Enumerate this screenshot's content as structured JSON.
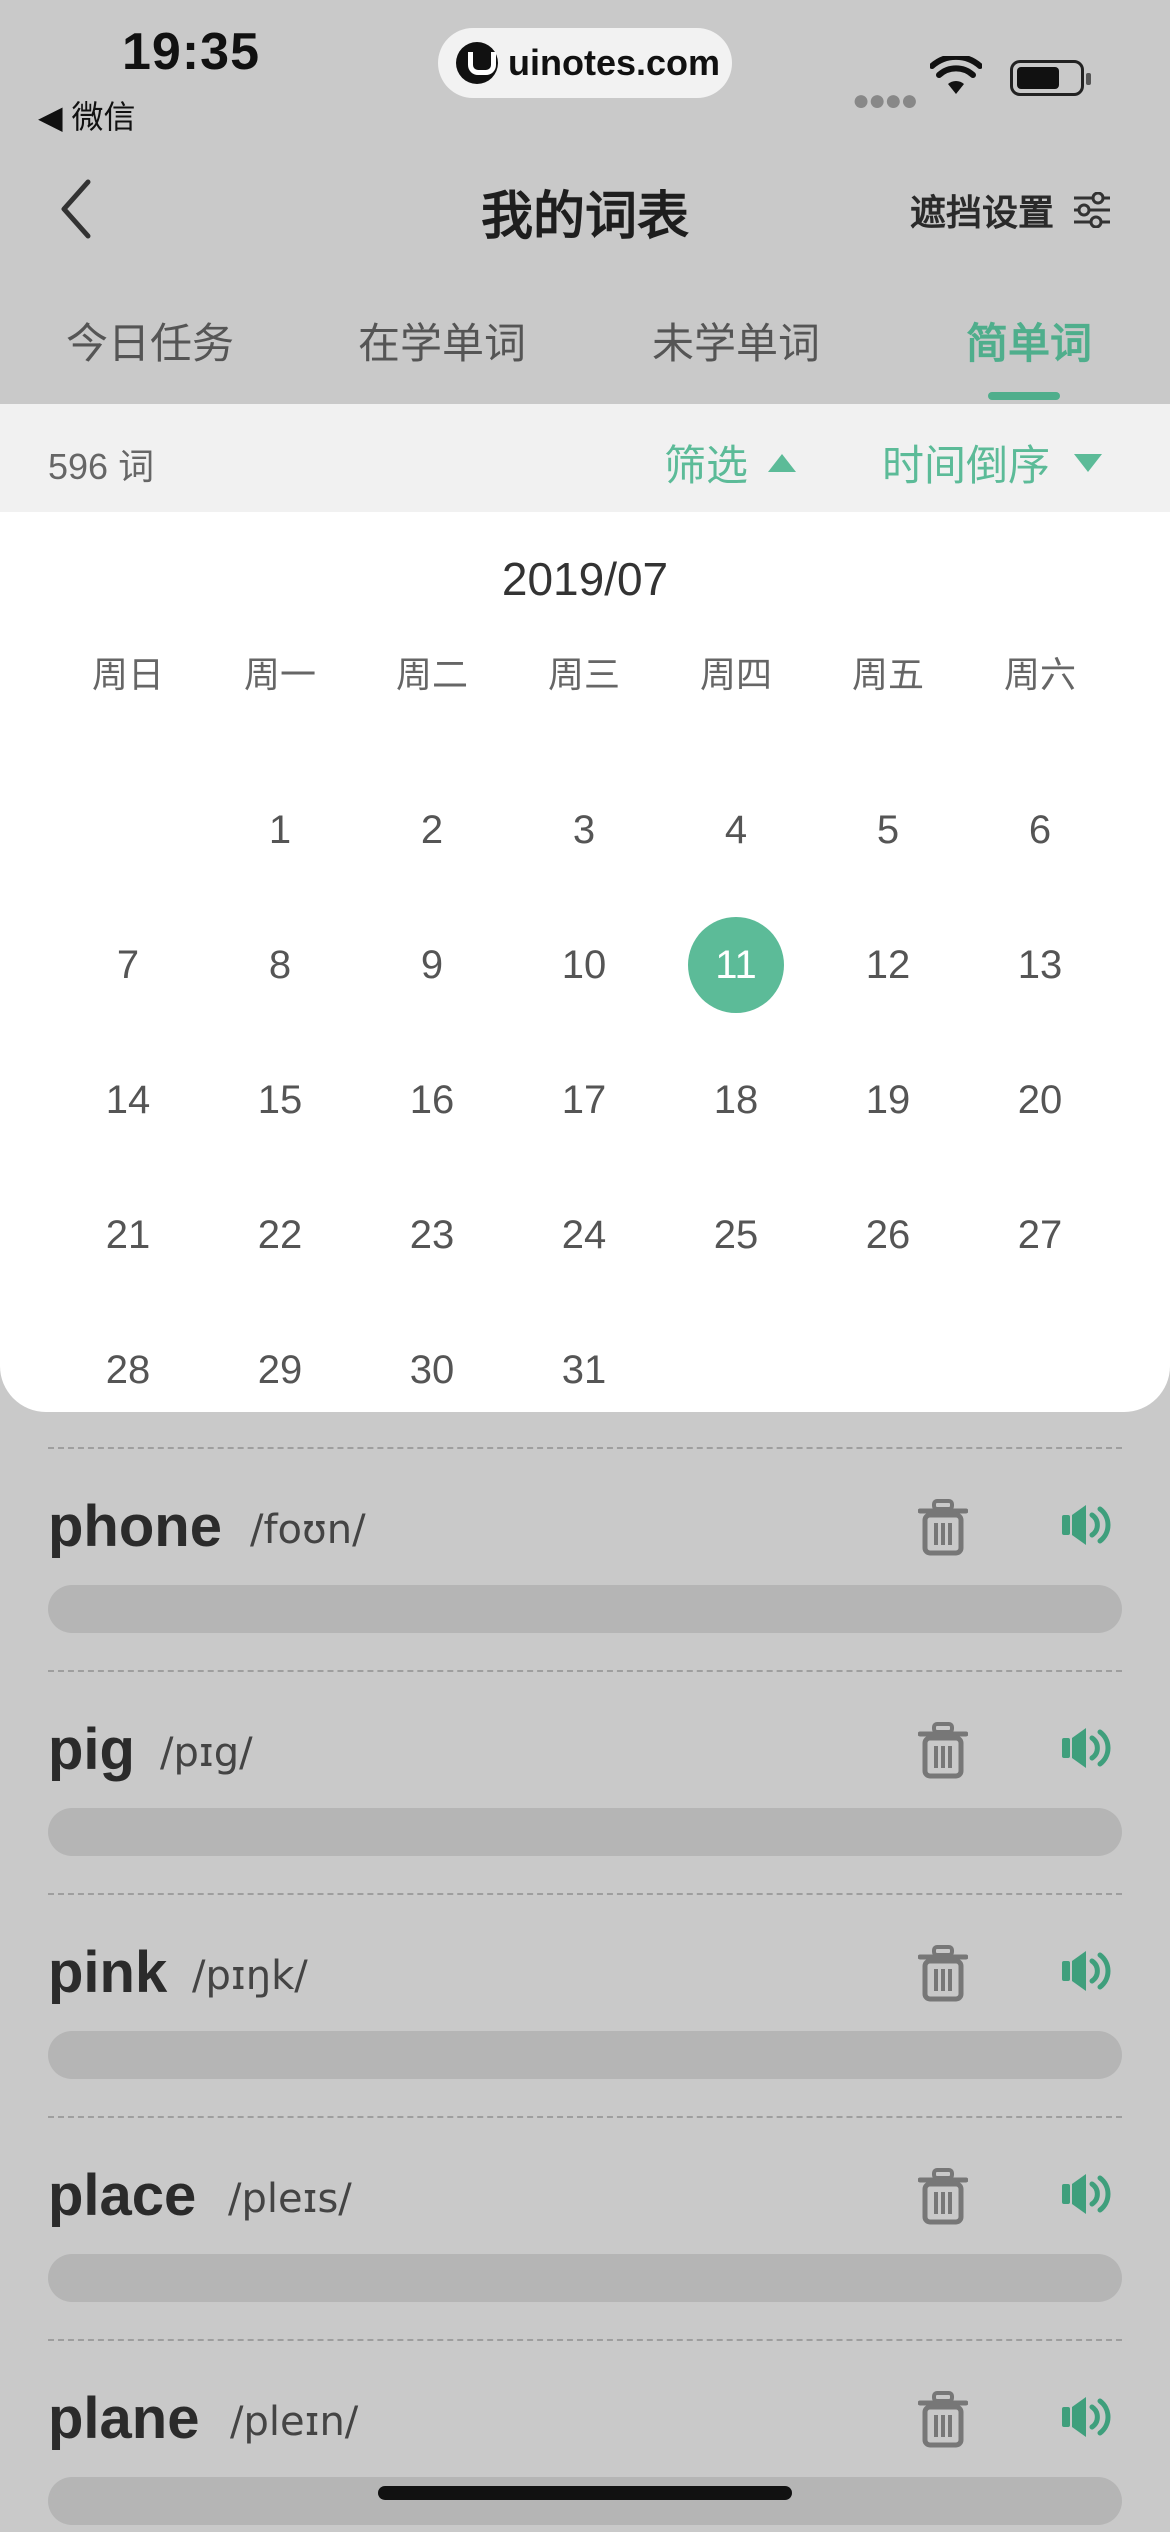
{
  "status_bar": {
    "time": "19:35",
    "back_app": "◀ 微信",
    "url": "uinotes.com"
  },
  "nav": {
    "title": "我的词表",
    "mask_settings": "遮挡设置"
  },
  "tabs": [
    {
      "label": "今日任务",
      "active": false
    },
    {
      "label": "在学单词",
      "active": false
    },
    {
      "label": "未学单词",
      "active": false
    },
    {
      "label": "简单词",
      "active": true
    }
  ],
  "filter_bar": {
    "count": "596 词",
    "filter_label": "筛选",
    "sort_label": "时间倒序"
  },
  "calendar": {
    "month": "2019/07",
    "weekdays": [
      "周日",
      "周一",
      "周二",
      "周三",
      "周四",
      "周五",
      "周六"
    ],
    "first_weekday": 1,
    "days_in_month": 31,
    "selected_day": 11,
    "accent_color": "#5cbb98"
  },
  "words": [
    {
      "word": "phone",
      "phonetic": "/foʊn/"
    },
    {
      "word": "pig",
      "phonetic": "/pɪg/"
    },
    {
      "word": "pink",
      "phonetic": "/pɪŋk/"
    },
    {
      "word": "place",
      "phonetic": "/pleɪs/"
    },
    {
      "word": "plane",
      "phonetic": "/pleɪn/"
    }
  ],
  "icons": {
    "delete": "trash-icon",
    "pronounce": "speaker-icon"
  },
  "colors": {
    "accent": "#4fae8c",
    "overlay_bg": "#c9c9c9"
  }
}
